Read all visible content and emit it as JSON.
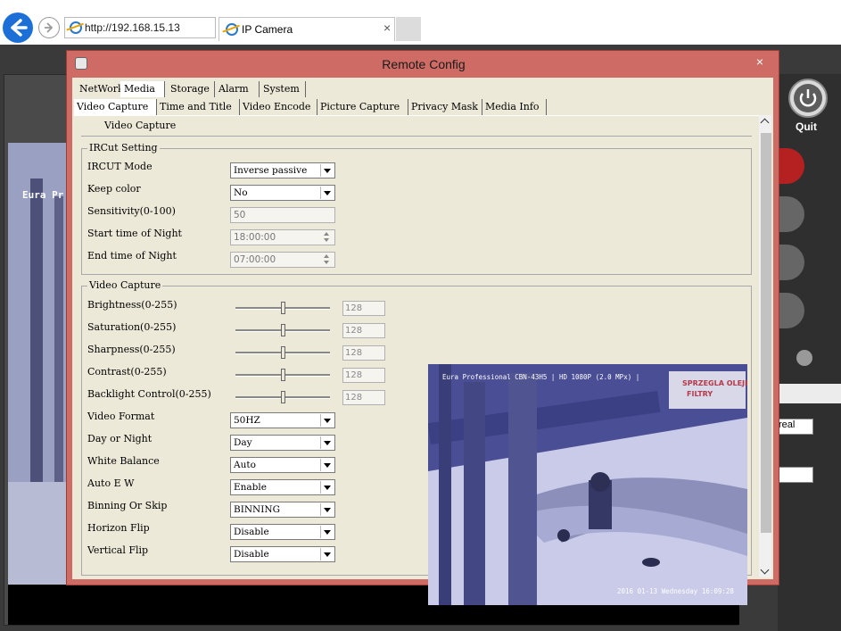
{
  "browser": {
    "address": "http://192.168.15.13",
    "tab_title": "IP Camera",
    "tab_close": "×"
  },
  "app": {
    "quit_label": "Quit",
    "bg_video_label": "Eura Pr",
    "side_select1": "real",
    "side_select2": ""
  },
  "dialog": {
    "title": "Remote Config",
    "close": "×",
    "top_tabs": [
      "NetWork",
      "Media",
      "Storage",
      "Alarm",
      "System"
    ],
    "active_top_tab": "Media",
    "sub_tabs": [
      "Video Capture",
      "Time and Title",
      "Video Encode",
      "Picture Capture",
      "Privacy Mask",
      "Media Info"
    ],
    "active_sub_tab": "Video Capture",
    "section_heading": "Video Capture",
    "ircut": {
      "title": "IRCut Setting",
      "mode_label": "IRCUT Mode",
      "mode_value": "Inverse passive",
      "keep_color_label": "Keep color",
      "keep_color_value": "No",
      "sensitivity_label": "Sensitivity(0-100)",
      "sensitivity_value": "50",
      "start_label": "Start time of Night",
      "start_value": "18:00:00",
      "end_label": "End time of Night",
      "end_value": "07:00:00"
    },
    "capture": {
      "title": "Video Capture",
      "sliders": [
        {
          "label": "Brightness(0-255)",
          "value": "128"
        },
        {
          "label": "Saturation(0-255)",
          "value": "128"
        },
        {
          "label": "Sharpness(0-255)",
          "value": "128"
        },
        {
          "label": "Contrast(0-255)",
          "value": "128"
        },
        {
          "label": "Backlight Control(0-255)",
          "value": "128"
        }
      ],
      "selects": [
        {
          "label": "Video Format",
          "value": "50HZ"
        },
        {
          "label": "Day or Night",
          "value": "Day"
        },
        {
          "label": "White Balance",
          "value": "Auto"
        },
        {
          "label": "Auto E  W",
          "value": "Enable"
        },
        {
          "label": "Binning Or Skip",
          "value": "BINNING"
        },
        {
          "label": "Horizon Flip",
          "value": "Disable"
        },
        {
          "label": "Vertical Flip",
          "value": "Disable"
        }
      ]
    },
    "preview": {
      "osd": "Eura Professional CBN-43H5 | HD 1080P (2.0 MPx) |",
      "timestamp": "2016 01-13 Wednesday 16:09:28",
      "sign": "SPRZEGLA OLEJE\nFILTRY"
    }
  }
}
